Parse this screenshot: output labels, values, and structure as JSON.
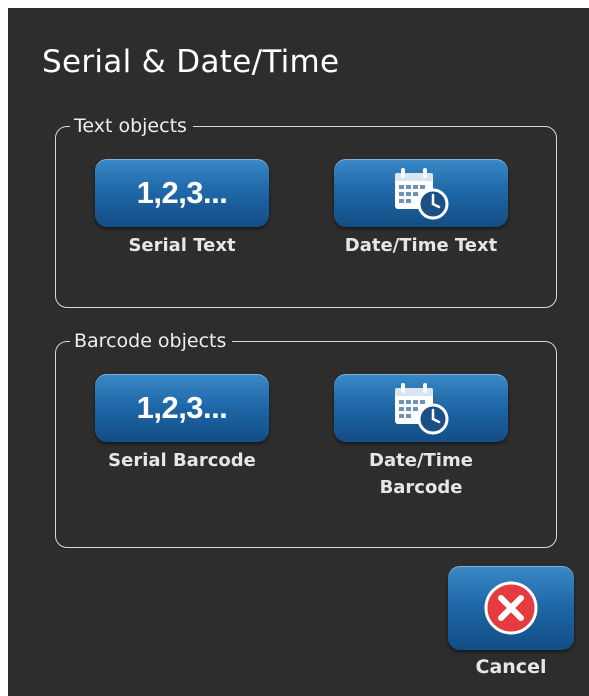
{
  "dialog": {
    "title": "Serial & Date/Time",
    "text_group": {
      "legend": "Text objects",
      "serial": {
        "glyph": "1,2,3...",
        "label": "Serial Text"
      },
      "datetime": {
        "icon": "calendar-clock-icon",
        "label": "Date/Time Text"
      }
    },
    "barcode_group": {
      "legend": "Barcode objects",
      "serial": {
        "glyph": "1,2,3...",
        "label": "Serial Barcode"
      },
      "datetime": {
        "icon": "calendar-clock-icon",
        "label_line1": "Date/Time",
        "label_line2": "Barcode"
      }
    },
    "cancel": {
      "icon": "close-icon",
      "label": "Cancel"
    }
  },
  "colors": {
    "dialog_bg": "#2d2d2d",
    "button_blue": "#1e67a8",
    "cancel_red": "#e53a40"
  }
}
